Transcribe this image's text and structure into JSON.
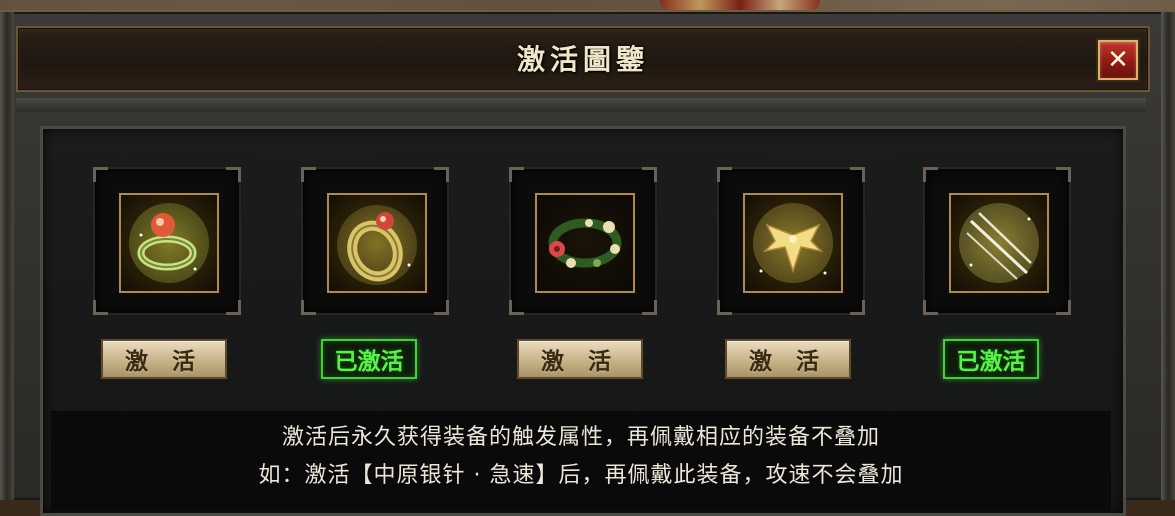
{
  "window": {
    "title": "激活圖鑒",
    "close_label": "✕"
  },
  "items": [
    {
      "icon": "jeweled-ring-icon",
      "button_label": "激 活",
      "state": "inactive"
    },
    {
      "icon": "gold-ring-icon",
      "button_label": "已激活",
      "state": "activated"
    },
    {
      "icon": "flower-wreath-icon",
      "button_label": "激 活",
      "state": "inactive"
    },
    {
      "icon": "golden-wings-icon",
      "button_label": "激 活",
      "state": "inactive"
    },
    {
      "icon": "silver-needles-icon",
      "button_label": "已激活",
      "state": "activated"
    }
  ],
  "info": {
    "line1": "激活后永久获得装备的触发属性，再佩戴相应的装备不叠加",
    "line2": "如：激活【中原银针 · 急速】后，再佩戴此装备，攻速不会叠加"
  },
  "colors": {
    "activated_green": "#59f24a",
    "title_text": "#f2e6c8",
    "close_red": "#c0352a"
  }
}
